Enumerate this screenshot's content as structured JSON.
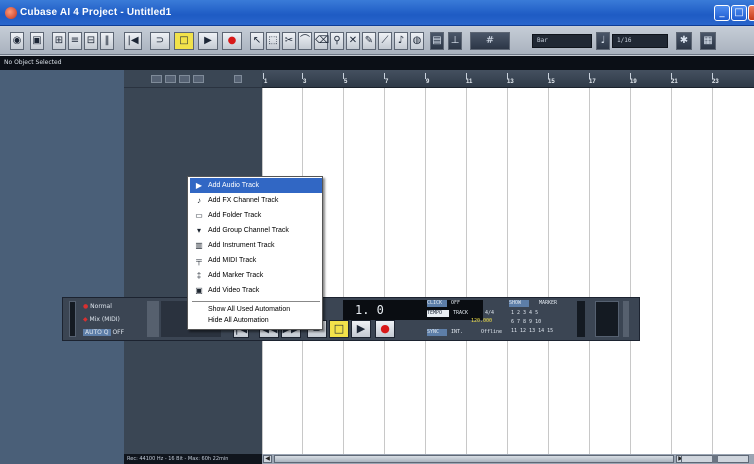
{
  "window": {
    "title": "Cubase AI 4 Project - Untitled1"
  },
  "toolbar": {
    "quantize_value": "Bar",
    "grid_value": "1/16"
  },
  "info_line": "No Object Selected",
  "status_bar": "Rec: 44100 Hz - 16 Bit - Max: 60h 22min",
  "ruler": {
    "bars": [
      "1",
      "3",
      "5",
      "7",
      "9",
      "11",
      "13",
      "15",
      "17",
      "19",
      "21",
      "23"
    ]
  },
  "context_menu": {
    "items": [
      {
        "label": "Add Audio Track",
        "icon": "audio-track-icon",
        "selected": true
      },
      {
        "label": "Add FX Channel Track",
        "icon": "fx-channel-icon"
      },
      {
        "label": "Add Folder Track",
        "icon": "folder-icon"
      },
      {
        "label": "Add Group Channel Track",
        "icon": "group-channel-icon"
      },
      {
        "label": "Add Instrument Track",
        "icon": "instrument-icon"
      },
      {
        "label": "Add MIDI Track",
        "icon": "midi-icon"
      },
      {
        "label": "Add Marker Track",
        "icon": "marker-icon"
      },
      {
        "label": "Add Video Track",
        "icon": "video-icon"
      }
    ],
    "automation": [
      {
        "label": "Show All Used Automation"
      },
      {
        "label": "Hide All Automation"
      }
    ]
  },
  "transport": {
    "mode": "Normal",
    "input": "Mix (MIDI)",
    "auto_q": "AUTO Q",
    "auto_q_value": "OFF",
    "position": "1. 0",
    "click_label": "CLICK",
    "click_value": "OFF",
    "tempo_label": "TEMPO",
    "track_label": "TRACK",
    "signature": "4/4",
    "tempo_value": "120.000",
    "sync_label": "SYNC",
    "sync_value": "INT.",
    "offline": "Offline",
    "show_label": "SHOW",
    "marker_label": "MARKER",
    "marker_row1": "1  2  3  4  5",
    "marker_row2": "6  7  8  9  10",
    "marker_row3": "11 12 13 14 15"
  }
}
